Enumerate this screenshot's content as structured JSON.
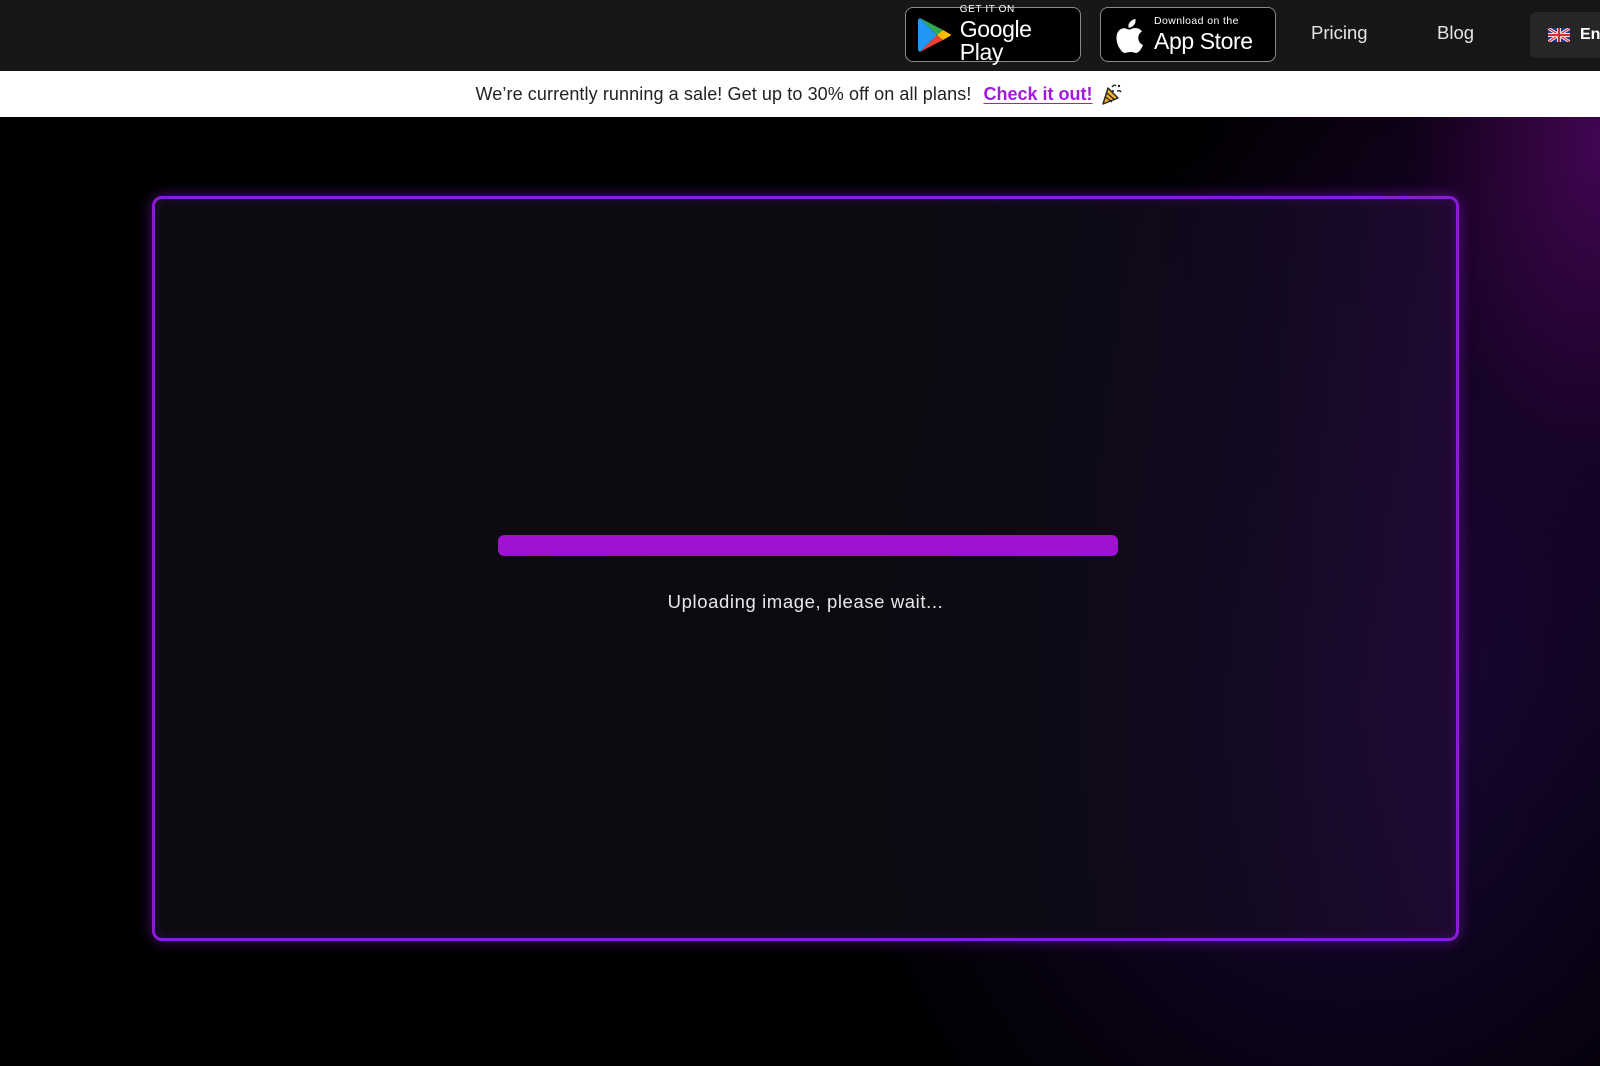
{
  "header": {
    "google_play": {
      "small_label": "GET IT ON",
      "big_label": "Google Play",
      "icon": "google-play-icon"
    },
    "app_store": {
      "small_label": "Download on the",
      "big_label": "App Store",
      "icon": "apple-icon"
    },
    "nav": {
      "pricing": "Pricing",
      "blog": "Blog"
    },
    "language": {
      "label": "En",
      "icon": "uk-flag-icon"
    }
  },
  "banner": {
    "text": "We’re currently running a sale! Get up to 30% off on all plans!",
    "link_text": "Check it out!",
    "emoji_icon": "party-popper-icon",
    "link_color": "#a21bd9"
  },
  "upload": {
    "progress_percent": 100,
    "status": "Uploading image, please wait...",
    "accent_color": "#a012d2",
    "border_color": "#8a1bd6"
  }
}
